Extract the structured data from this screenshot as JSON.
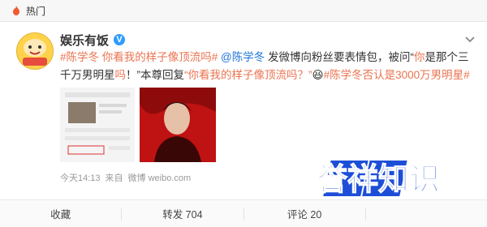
{
  "section": {
    "label": "热门"
  },
  "post": {
    "author": "娱乐有饭",
    "content": {
      "tag1": "#陈学冬 你看我的样子像顶流吗#",
      "mention": "@陈学冬",
      "text1": " 发微博向粉丝要表情包，被问“",
      "quote_red": "你",
      "text2": "是那个三千万男明星",
      "quote_red2": "吗",
      "text3": "！”本尊回复",
      "tag2": "“你看我的样子像顶流吗？”",
      "emoji": "😆",
      "tag3": "#陈学冬否认是3000万男明星#"
    },
    "time": "今天14:13",
    "source_prefix": "来自",
    "source": "微博 weibo.com"
  },
  "actions": {
    "favorite": "收藏",
    "repost": "转发 704",
    "comment": "评论 20"
  },
  "watermark": {
    "text": "誉祥知识"
  }
}
